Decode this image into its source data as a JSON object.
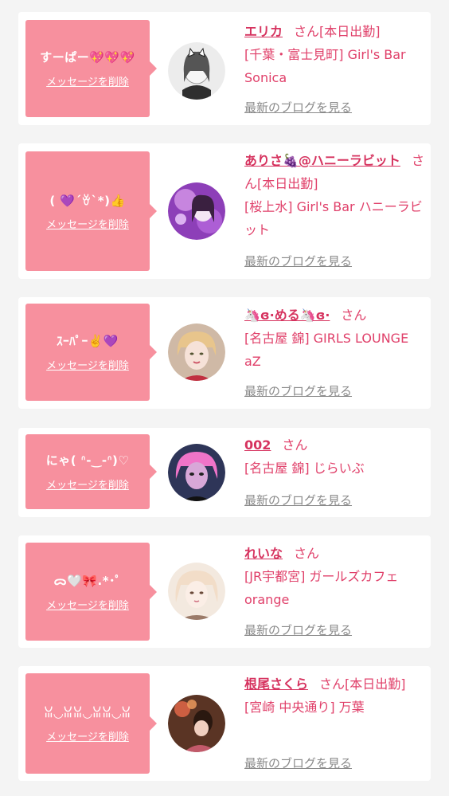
{
  "entries": [
    {
      "message": "すーぱー💖💖💖",
      "delete_label": "メッセージを削除",
      "name": "エリカ",
      "honorific": "さん",
      "status": "[本日出勤]",
      "shop": "[千葉・富士見町] Girl's Bar Sonica",
      "blog_label": "最新のブログを見る",
      "avatar_colors": [
        "#e6e6e6",
        "#9a9a9a"
      ]
    },
    {
      "message": "( 💜´ꈊ`*)👍",
      "delete_label": "メッセージを削除",
      "name": "ありさ🍇@ハニーラビット",
      "honorific": "さん",
      "status": "[本日出勤]",
      "shop": "[桜上水] Girl's Bar ハニーラビット",
      "blog_label": "最新のブログを見る",
      "avatar_colors": [
        "#c77ae6",
        "#6b2f92"
      ]
    },
    {
      "message": "ｽｰﾊﾟｰ✌️💜",
      "delete_label": "メッセージを削除",
      "name": "🦄ɞ·める🦄ɞ·",
      "honorific": "さん",
      "status": "",
      "shop": "[名古屋 錦] GIRLS LOUNGE aZ",
      "blog_label": "最新のブログを見る",
      "avatar_colors": [
        "#e9c9a8",
        "#7a4a3a"
      ]
    },
    {
      "message": "にゃ( ᐢ-‿-ᐢ)♡",
      "delete_label": "メッセージを削除",
      "name": "002",
      "honorific": "さん",
      "status": "",
      "shop": "[名古屋 錦] じらいぶ",
      "blog_label": "最新のブログを見る",
      "avatar_colors": [
        "#e870c8",
        "#3a3a5a"
      ]
    },
    {
      "message": "ᯅ🤍🎀.*･ﾟ",
      "delete_label": "メッセージを削除",
      "name": "れいな",
      "honorific": "さん",
      "status": "",
      "shop": "[JR宇都宮] ガールズカフェ orange",
      "blog_label": "最新のブログを見る",
      "avatar_colors": [
        "#efe2d6",
        "#8c6a55"
      ]
    },
    {
      "message": "ꈍ◡ꈍꈍ◡ꈍꈍ◡ꈍ",
      "delete_label": "メッセージを削除",
      "name": "根尾さくら",
      "honorific": "さん",
      "status": "[本日出勤]",
      "shop": "[宮崎 中央通り] 万葉",
      "blog_label": "最新のブログを見る",
      "avatar_colors": [
        "#d96a4a",
        "#3a2418"
      ]
    }
  ]
}
